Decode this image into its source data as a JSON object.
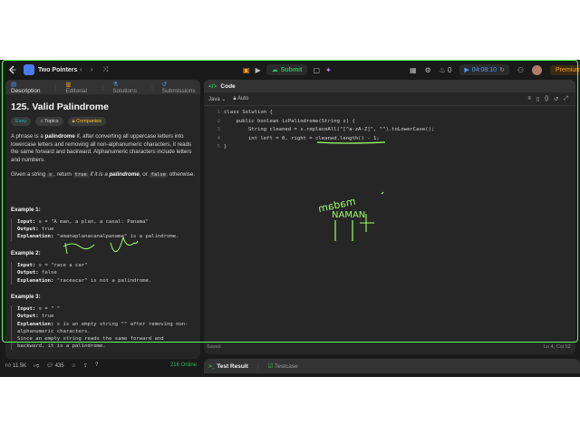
{
  "topbar": {
    "problem_list": "Two Pointers",
    "submit": "Submit",
    "timer": "04:08:10",
    "fire_count": "0",
    "premium": "Premium"
  },
  "left_tabs": [
    "Description",
    "Editorial",
    "Solutions",
    "Submissions"
  ],
  "problem": {
    "title": "125. Valid Palindrome",
    "tags": [
      "Easy",
      "Topics",
      "Companies"
    ],
    "p1_a": "A phrase is a ",
    "p1_b": "palindrome",
    "p1_c": " if, after converting all uppercase letters into lowercase letters and removing all non-alphanumeric characters, it reads the same forward and backward. Alphanumeric characters include letters and numbers.",
    "p2_a": "Given a string ",
    "p2_s": "s",
    "p2_b": ", return ",
    "p2_true": "true",
    "p2_c": " if it is a ",
    "p2_pal": "palindrome",
    "p2_d": ", or ",
    "p2_false": "false",
    "p2_e": " otherwise."
  },
  "examples": [
    {
      "title": "Example 1:",
      "input": "s = \"A man, a plan, a canal: Panama\"",
      "output": "true",
      "explanation": "\"amanaplanacanalpanama\" is a palindrome."
    },
    {
      "title": "Example 2:",
      "input": "s = \"race a car\"",
      "output": "false",
      "explanation": "\"raceacar\" is not a palindrome."
    },
    {
      "title": "Example 3:",
      "input": "s = \" \"",
      "output": "true",
      "explanation": "s is an empty string \"\" after removing non-alphanumeric characters.",
      "explanation2": "Since an empty string reads the same forward and",
      "explanation3": "backward, it is a palindrome."
    }
  ],
  "labels": {
    "input": "Input:",
    "output": "Output:",
    "explanation": "Explanation:"
  },
  "footer": {
    "likes": "11.5K",
    "comments": "435",
    "online": "216 Online"
  },
  "code": {
    "tab": "Code",
    "language": "Java",
    "mode": "Auto",
    "status": "Saved",
    "cursor": "Ln 4, Col 52",
    "lines": [
      "class Solution {",
      "    public boolean isPalindrome(String s) {",
      "        String cleaned = s.replaceAll(\"[^a-zA-Z]\", \"\").toLowerCase();",
      "        int left = 0, right = cleaned.length() - 1;",
      "}"
    ]
  },
  "bottom_tabs": [
    "Test Result",
    "Testcase"
  ],
  "annotations": {
    "handwriting_1": "NAMAN",
    "handwriting_2": "madam"
  }
}
